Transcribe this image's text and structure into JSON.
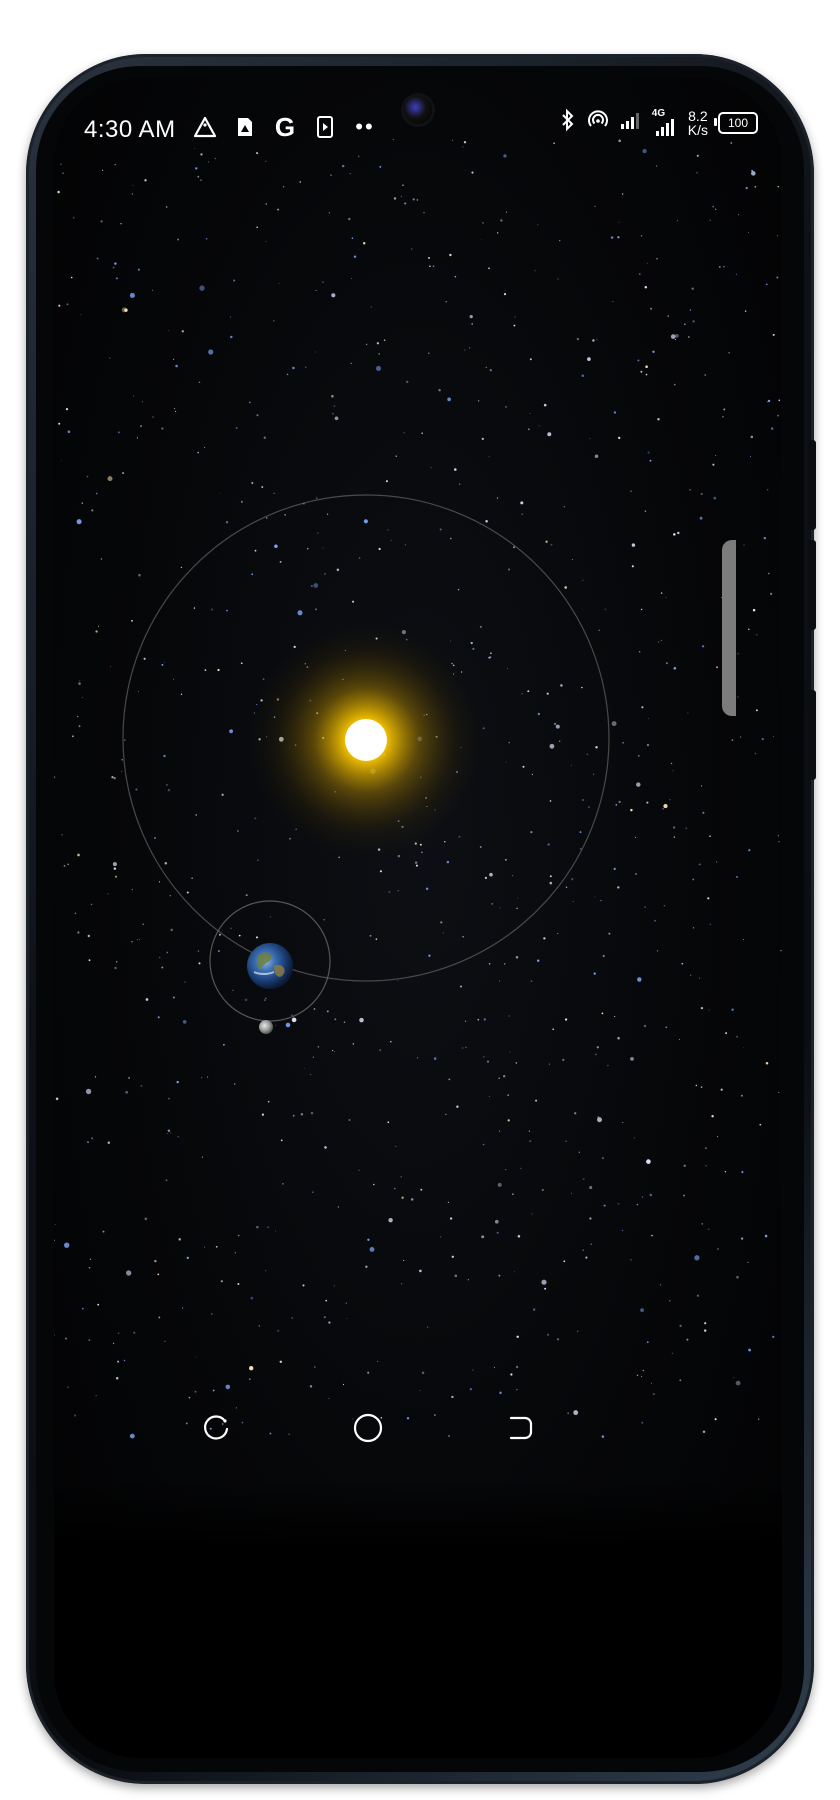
{
  "status_bar": {
    "time": "4:30 AM",
    "left_icons": [
      "triangle-alert-icon",
      "sim-card-icon",
      "google-g-icon",
      "play-file-icon",
      "more-dots-icon"
    ],
    "google_letter": "G",
    "dots": "••",
    "right_icons": [
      "bluetooth-icon",
      "hotspot-icon",
      "signal-icon",
      "signal-4g-icon"
    ],
    "network_type": "4G",
    "net_speed_value": "8.2",
    "net_speed_unit": "K/s",
    "battery": "100"
  },
  "colors": {
    "sun_core": "#ffffff",
    "sun_glow": "#f2c200",
    "orbit_line": "#5a5a5a",
    "background": "#050507"
  },
  "navigation": {
    "buttons": [
      "recents-icon",
      "home-icon",
      "back-icon"
    ]
  }
}
